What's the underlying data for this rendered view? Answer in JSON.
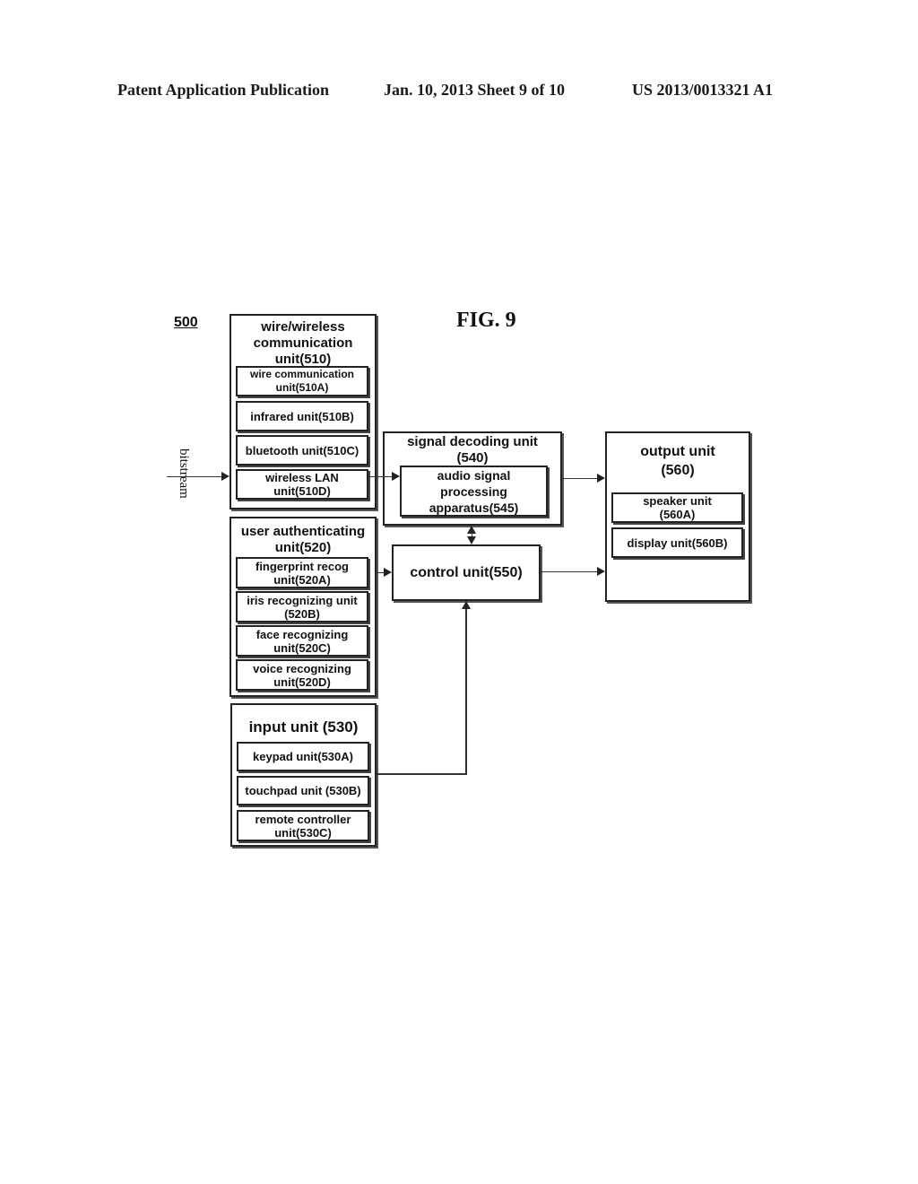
{
  "header": {
    "publication": "Patent Application Publication",
    "date_sheet": "Jan. 10, 2013   Sheet 9 of 10",
    "pub_number": "US 2013/0013321 A1"
  },
  "figure": {
    "label": "FIG. 9",
    "ref": "500",
    "input_label": "bitstream"
  },
  "blocks": {
    "comm": {
      "title": "wire/wireless communication unit(510)",
      "items": [
        "wire communication unit(510A)",
        "infrared unit(510B)",
        "bluetooth unit(510C)",
        "wireless LAN unit(510D)"
      ]
    },
    "auth": {
      "title": "user authenticating unit(520)",
      "items": [
        "fingerprint recog unit(520A)",
        "iris recognizing unit (520B)",
        "face recognizing unit(520C)",
        "voice recognizing unit(520D)"
      ]
    },
    "input": {
      "title": "input unit (530)",
      "items": [
        "keypad unit(530A)",
        "touchpad unit (530B)",
        "remote controller unit(530C)"
      ]
    },
    "decoding": {
      "title": "signal decoding unit (540)",
      "items": [
        "audio signal processing apparatus(545)"
      ]
    },
    "control": {
      "title": "control unit(550)"
    },
    "output": {
      "title": "output unit (560)",
      "items": [
        "speaker unit (560A)",
        "display unit(560B)"
      ]
    }
  }
}
